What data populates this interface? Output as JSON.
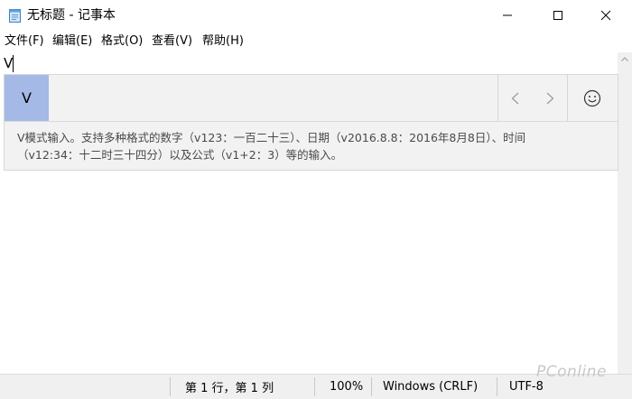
{
  "window": {
    "title": "无标题 - 记事本",
    "icon": "notepad-icon",
    "controls": [
      "minimize-icon",
      "maximize-icon",
      "close-icon"
    ]
  },
  "menu": {
    "items": [
      "文件(F)",
      "编辑(E)",
      "格式(O)",
      "查看(V)",
      "帮助(H)"
    ]
  },
  "editor": {
    "text": "V"
  },
  "ime": {
    "candidate": "V",
    "prev_icon": "chevron-left-icon",
    "next_icon": "chevron-right-icon",
    "emoji_icon": "emoji-smile-icon",
    "description_line1": "V模式输入。支持多种格式的数字（v123：一百二十三）、日期（v2016.8.8：2016年8月8日）、时间",
    "description_line2": "（v12:34：十二时三十四分）以及公式（v1+2：3）等的输入。",
    "highlight_color": "#a5b9e6"
  },
  "statusbar": {
    "position": "第 1 行，第 1 列",
    "zoom": "100%",
    "line_ending": "Windows (CRLF)",
    "encoding": "UTF-8"
  },
  "watermark": "PConline"
}
